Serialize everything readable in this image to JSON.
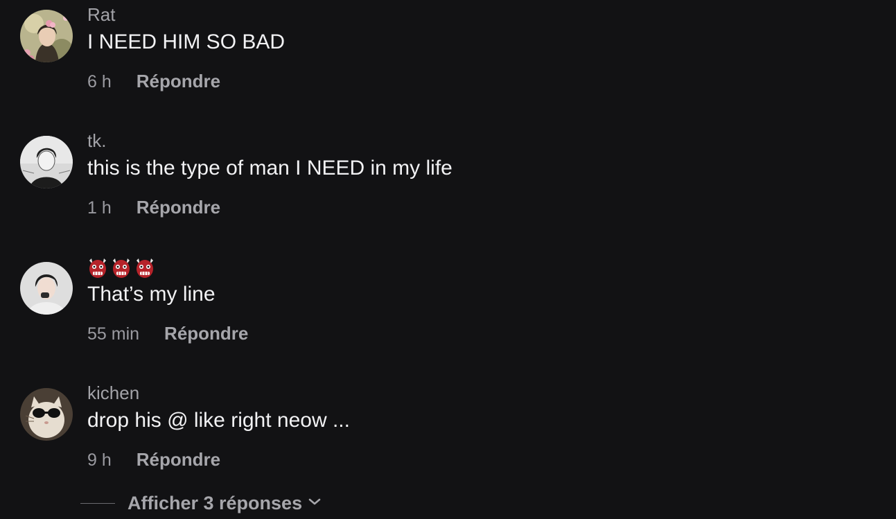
{
  "comments": [
    {
      "username": "Rat",
      "text": "I NEED HIM SO BAD",
      "time": "6 h",
      "reply_label": "Répondre",
      "avatar_icon": "avatar-flower-girl"
    },
    {
      "username": "tk.",
      "text": "this is the type of man I NEED in my life",
      "time": "1 h",
      "reply_label": "Répondre",
      "avatar_icon": "avatar-sketch-boy"
    },
    {
      "username_emojis": [
        "👹",
        "👹",
        "👹"
      ],
      "text": "That’s my line",
      "time": "55 min",
      "reply_label": "Répondre",
      "avatar_icon": "avatar-photo-person"
    },
    {
      "username": "kichen",
      "text": "drop his @ like right neow ...",
      "time": "9 h",
      "reply_label": "Répondre",
      "avatar_icon": "avatar-cat-sunglasses"
    }
  ],
  "show_replies": {
    "label": "Afficher 3 réponses",
    "icon": "chevron-down-icon"
  },
  "colors": {
    "background": "#121214",
    "text_primary": "#f2f2f4",
    "text_secondary": "#a3a3a8"
  }
}
